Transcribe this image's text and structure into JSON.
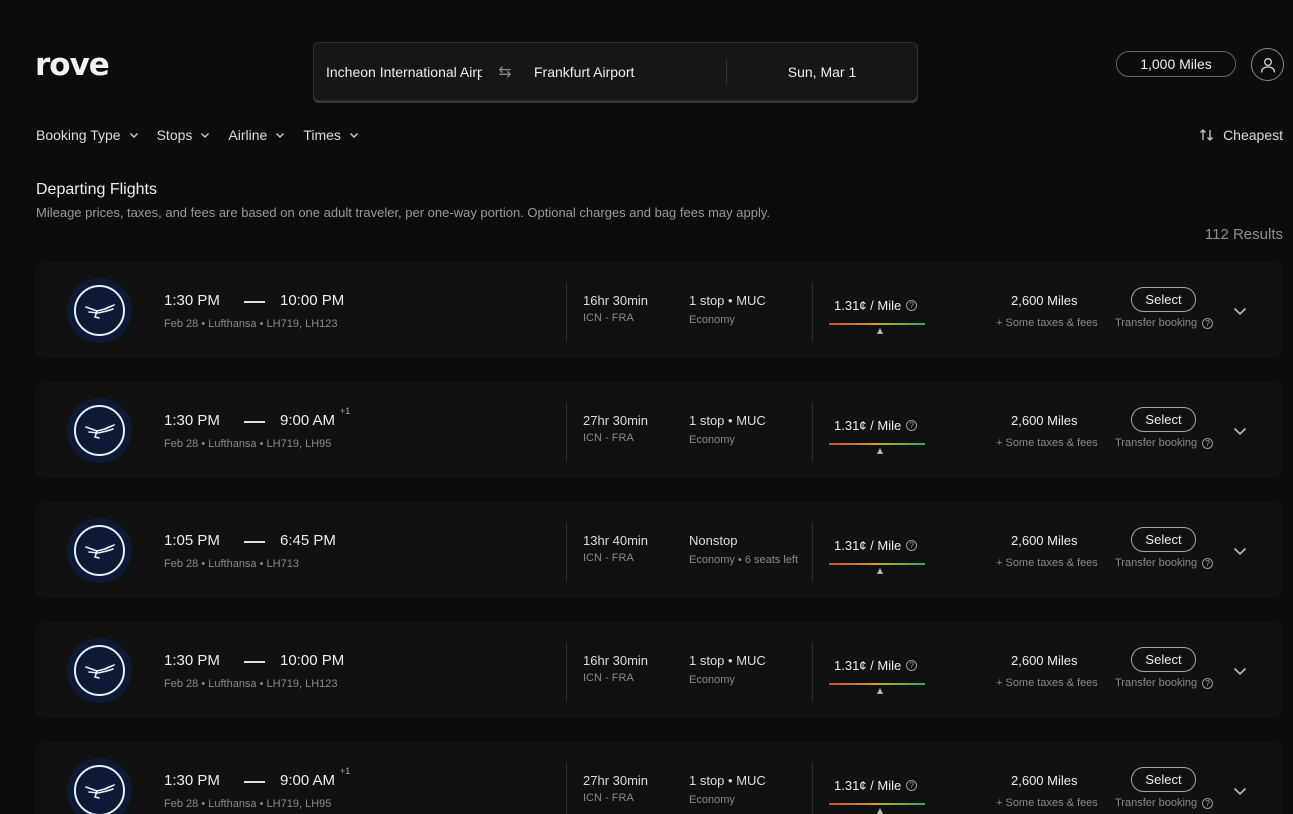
{
  "brand": {
    "logo_text": "rove"
  },
  "search": {
    "origin": "Incheon International Airport",
    "destination": "Frankfurt Airport",
    "date": "Sun, Mar 1"
  },
  "account": {
    "miles_balance": "1,000 Miles"
  },
  "filters": [
    {
      "label": "Booking Type"
    },
    {
      "label": "Stops"
    },
    {
      "label": "Airline"
    },
    {
      "label": "Times"
    }
  ],
  "sort": {
    "label": "Cheapest"
  },
  "section": {
    "title": "Departing Flights",
    "subtitle": "Mileage prices, taxes, and fees are based on one adult traveler, per one-way portion. Optional charges and bag fees may apply.",
    "results": "112 Results"
  },
  "flights": [
    {
      "depart": "1:30 PM",
      "arrive": "10:00 PM",
      "plus_day": "",
      "date": "Feb 28",
      "airline": "Lufthansa",
      "flight_numbers": "LH719, LH123",
      "duration": "16hr 30min",
      "route": "ICN - FRA",
      "stops": "1 stop • MUC",
      "cabin": "Economy",
      "cpm": "1.31¢ / Mile",
      "value_position": 0.53,
      "miles": "2,600 Miles",
      "taxes": "+ Some taxes & fees",
      "select_label": "Select",
      "transfer_label": "Transfer booking"
    },
    {
      "depart": "1:30 PM",
      "arrive": "9:00 AM",
      "plus_day": "+1",
      "date": "Feb 28",
      "airline": "Lufthansa",
      "flight_numbers": "LH719, LH95",
      "duration": "27hr 30min",
      "route": "ICN - FRA",
      "stops": "1 stop • MUC",
      "cabin": "Economy",
      "cpm": "1.31¢ / Mile",
      "value_position": 0.53,
      "miles": "2,600 Miles",
      "taxes": "+ Some taxes & fees",
      "select_label": "Select",
      "transfer_label": "Transfer booking"
    },
    {
      "depart": "1:05 PM",
      "arrive": "6:45 PM",
      "plus_day": "",
      "date": "Feb 28",
      "airline": "Lufthansa",
      "flight_numbers": "LH713",
      "duration": "13hr 40min",
      "route": "ICN - FRA",
      "stops": "Nonstop",
      "cabin": "Economy • 6 seats left",
      "cpm": "1.31¢ / Mile",
      "value_position": 0.53,
      "miles": "2,600 Miles",
      "taxes": "+ Some taxes & fees",
      "select_label": "Select",
      "transfer_label": "Transfer booking"
    },
    {
      "depart": "1:30 PM",
      "arrive": "10:00 PM",
      "plus_day": "",
      "date": "Feb 28",
      "airline": "Lufthansa",
      "flight_numbers": "LH719, LH123",
      "duration": "16hr 30min",
      "route": "ICN - FRA",
      "stops": "1 stop • MUC",
      "cabin": "Economy",
      "cpm": "1.31¢ / Mile",
      "value_position": 0.53,
      "miles": "2,600 Miles",
      "taxes": "+ Some taxes & fees",
      "select_label": "Select",
      "transfer_label": "Transfer booking"
    },
    {
      "depart": "1:30 PM",
      "arrive": "9:00 AM",
      "plus_day": "+1",
      "date": "Feb 28",
      "airline": "Lufthansa",
      "flight_numbers": "LH719, LH95",
      "duration": "27hr 30min",
      "route": "ICN - FRA",
      "stops": "1 stop • MUC",
      "cabin": "Economy",
      "cpm": "1.31¢ / Mile",
      "value_position": 0.53,
      "miles": "2,600 Miles",
      "taxes": "+ Some taxes & fees",
      "select_label": "Select",
      "transfer_label": "Transfer booking"
    }
  ],
  "colors": {
    "background": "#0c0c0c",
    "card": "#111111",
    "airline_badge": "#0d1a36",
    "value_low": "#c84a3a",
    "value_high": "#3aa84a"
  },
  "icons": {
    "swap": "swap-arrows-icon",
    "profile": "user-icon",
    "filter_chevron": "chevron-down-icon",
    "sort": "sort-arrows-icon",
    "info": "question-icon",
    "expand": "chevron-down-icon",
    "airline": "crane-logo-icon"
  }
}
